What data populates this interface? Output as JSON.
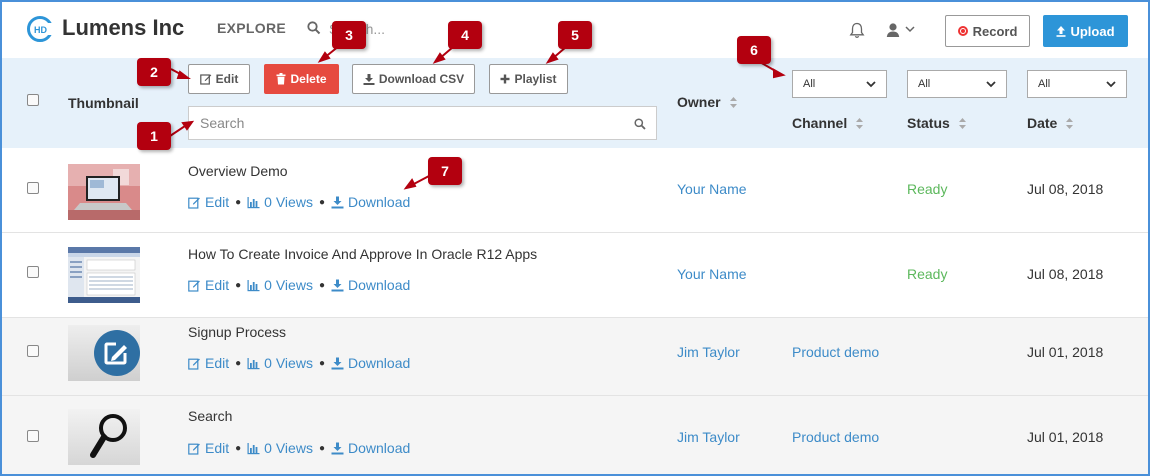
{
  "brand": {
    "name": "Lumens Inc",
    "logo_letters": "HD"
  },
  "nav": {
    "explore_label": "EXPLORE",
    "search_placeholder": "Search...",
    "record_label": "Record",
    "upload_label": "Upload"
  },
  "toolbar": {
    "edit_label": "Edit",
    "delete_label": "Delete",
    "download_csv_label": "Download CSV",
    "playlist_label": "Playlist",
    "search_placeholder": "Search"
  },
  "table": {
    "headers": {
      "thumbnail": "Thumbnail",
      "owner": "Owner",
      "channel": "Channel",
      "status": "Status",
      "date": "Date"
    },
    "filters": {
      "channel": "All",
      "status": "All",
      "date": "All"
    },
    "action_labels": {
      "edit": "Edit",
      "views": "0 Views",
      "download": "Download"
    },
    "rows": [
      {
        "title": "Overview Demo",
        "owner": "Your Name",
        "channel": "",
        "status": "Ready",
        "date": "Jul 08, 2018",
        "thumb": "laptop"
      },
      {
        "title": "How To Create Invoice And Approve In Oracle R12 Apps",
        "owner": "Your Name",
        "channel": "",
        "status": "Ready",
        "date": "Jul 08, 2018",
        "thumb": "screenshot"
      },
      {
        "title": "Signup Process",
        "owner": "Jim Taylor",
        "channel": "Product demo",
        "status": "",
        "date": "Jul 01, 2018",
        "thumb": "edit-badge"
      },
      {
        "title": "Search",
        "owner": "Jim Taylor",
        "channel": "Product demo",
        "status": "",
        "date": "Jul 01, 2018",
        "thumb": "magnifier"
      }
    ]
  },
  "callouts": [
    "1",
    "2",
    "3",
    "4",
    "5",
    "6",
    "7"
  ],
  "colors": {
    "accent": "#2d95d8",
    "link": "#3d8bc8",
    "ready": "#5cb85c",
    "delete": "#e64a3f",
    "callout": "#b3000f",
    "header_band": "#e6f1fa",
    "frame_border": "#4a90d9"
  }
}
